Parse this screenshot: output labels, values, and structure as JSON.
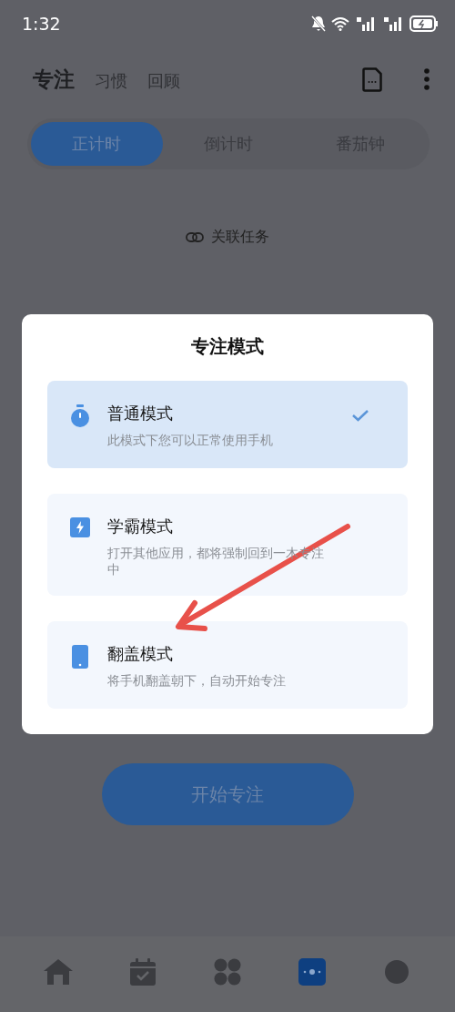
{
  "status_bar": {
    "time": "1:32"
  },
  "header": {
    "tabs": [
      {
        "label": "专注",
        "selected": true
      },
      {
        "label": "习惯",
        "selected": false
      },
      {
        "label": "回顾",
        "selected": false
      }
    ]
  },
  "timer_tabs": [
    {
      "label": "正计时",
      "selected": true
    },
    {
      "label": "倒计时",
      "selected": false
    },
    {
      "label": "番茄钟",
      "selected": false
    }
  ],
  "link_task": {
    "label": "关联任务"
  },
  "dialog": {
    "title": "专注模式",
    "options": [
      {
        "kind": "timer",
        "title": "普通模式",
        "description": "此模式下您可以正常使用手机",
        "selected": true
      },
      {
        "kind": "bolt",
        "title": "学霸模式",
        "description": "打开其他应用，都将强制回到一木专注中",
        "selected": false
      },
      {
        "kind": "phone",
        "title": "翻盖模式",
        "description": "将手机翻盖朝下，自动开始专注",
        "selected": false
      }
    ]
  },
  "start_button": {
    "label": "开始专注"
  },
  "bottom_nav": [
    {
      "kind": "home",
      "selected": false
    },
    {
      "kind": "calendar",
      "selected": false
    },
    {
      "kind": "grid",
      "selected": false
    },
    {
      "kind": "focus",
      "selected": true
    },
    {
      "kind": "avatar",
      "selected": false
    }
  ]
}
